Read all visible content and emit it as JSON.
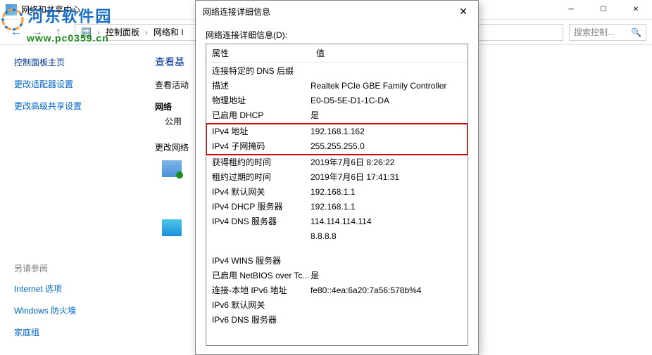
{
  "bgWindow": {
    "title": "网络和共享中心",
    "breadcrumb": {
      "p1": "控制面板",
      "p2": "网络和 I"
    },
    "searchPlaceholder": "搜索控制..."
  },
  "sidebar": {
    "title": "控制面板主页",
    "links": [
      "更改适配器设置",
      "更改高级共享设置"
    ],
    "seeAlsoTitle": "另请参阅",
    "seeAlso": [
      "Internet 选项",
      "Windows 防火墙",
      "家庭组"
    ]
  },
  "mainContent": {
    "heading": "查看基",
    "sub": "查看活动",
    "netSection": "网络",
    "netLabel": "公用",
    "changeLabel": "更改网络"
  },
  "modal": {
    "title": "网络连接详细信息",
    "label": "网络连接详细信息(D):",
    "headerProp": "属性",
    "headerVal": "值",
    "rows": [
      {
        "prop": "连接特定的 DNS 后缀",
        "val": ""
      },
      {
        "prop": "描述",
        "val": "Realtek PCIe GBE Family Controller"
      },
      {
        "prop": "物理地址",
        "val": "E0-D5-5E-D1-1C-DA"
      },
      {
        "prop": "已启用 DHCP",
        "val": "是"
      }
    ],
    "highlighted": [
      {
        "prop": "IPv4 地址",
        "val": "192.168.1.162"
      },
      {
        "prop": "IPv4 子网掩码",
        "val": "255.255.255.0"
      }
    ],
    "rows2": [
      {
        "prop": "获得租约的时间",
        "val": "2019年7月6日 8:26:22"
      },
      {
        "prop": "租约过期的时间",
        "val": "2019年7月6日 17:41:31"
      },
      {
        "prop": "IPv4 默认网关",
        "val": "192.168.1.1"
      },
      {
        "prop": "IPv4 DHCP 服务器",
        "val": "192.168.1.1"
      },
      {
        "prop": "IPv4 DNS 服务器",
        "val": "114.114.114.114"
      },
      {
        "prop": "",
        "val": "8.8.8.8"
      }
    ],
    "rows3": [
      {
        "prop": "IPv4 WINS 服务器",
        "val": ""
      },
      {
        "prop": "已启用 NetBIOS over Tc...",
        "val": "是"
      },
      {
        "prop": "连接-本地 IPv6 地址",
        "val": "fe80::4ea:6a20:7a56:578b%4"
      },
      {
        "prop": "IPv6 默认网关",
        "val": ""
      },
      {
        "prop": "IPv6 DNS 服务器",
        "val": ""
      }
    ]
  },
  "watermark": {
    "text1": "河东软件园",
    "url": "www.pc0359.cn"
  }
}
